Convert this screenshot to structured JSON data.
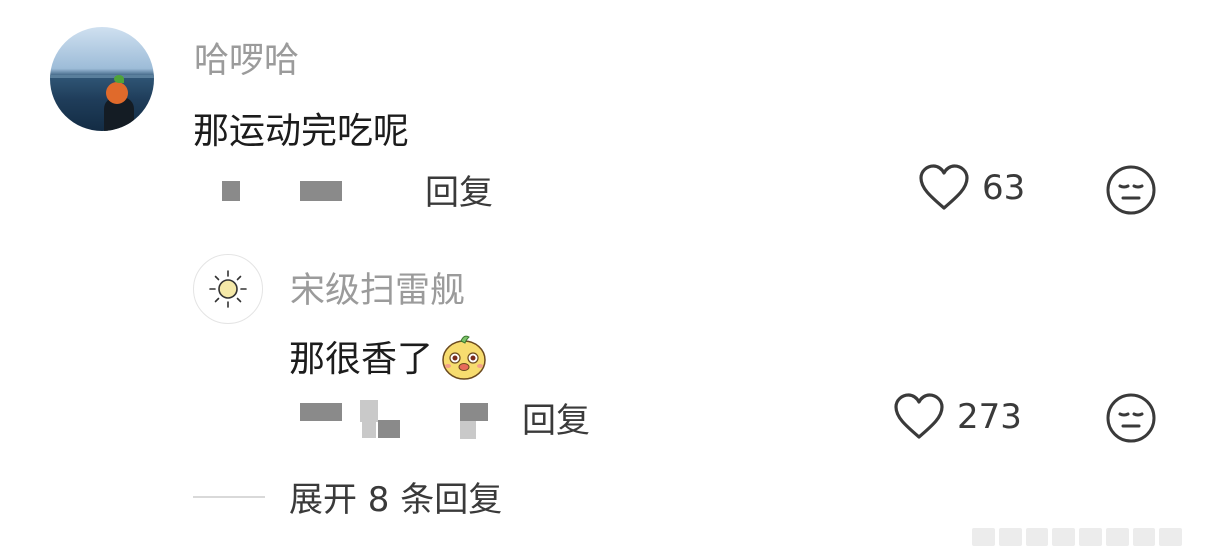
{
  "comment": {
    "username": "哈啰哈",
    "text": "那运动完吃呢",
    "reply_label": "回复",
    "like_count": "63"
  },
  "reply": {
    "username": "宋级扫雷舰",
    "text": "那很香了",
    "reply_label": "回复",
    "like_count": "273"
  },
  "expand_label": "展开 8 条回复",
  "colors": {
    "username": "#9b9b9b",
    "text": "#1c1c1c",
    "secondary": "#3a3a3a",
    "divider": "#d9d9d9"
  },
  "icons": {
    "like": "heart-outline-icon",
    "dislike": "neutral-face-icon",
    "sun_avatar": "sun-icon",
    "inline_emoji": "cartoon-face-emoji"
  }
}
